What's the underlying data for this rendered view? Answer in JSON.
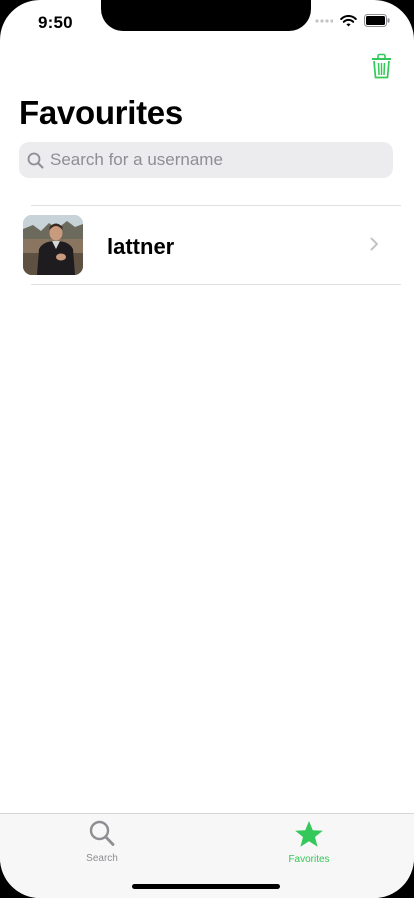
{
  "status_bar": {
    "time": "9:50"
  },
  "nav": {
    "title": "Favourites",
    "trash_icon": "trash-icon",
    "accent_color": "#34c759"
  },
  "search": {
    "placeholder": "Search for a username",
    "value": ""
  },
  "favorites": [
    {
      "username": "lattner",
      "avatar": "profile-photo"
    }
  ],
  "tab_bar": {
    "tabs": [
      {
        "label": "Search",
        "icon": "magnifying-glass-icon",
        "selected": false
      },
      {
        "label": "Favorites",
        "icon": "star-icon",
        "selected": true
      }
    ],
    "selected_color": "#34c759",
    "unselected_color": "#8e8e93"
  }
}
